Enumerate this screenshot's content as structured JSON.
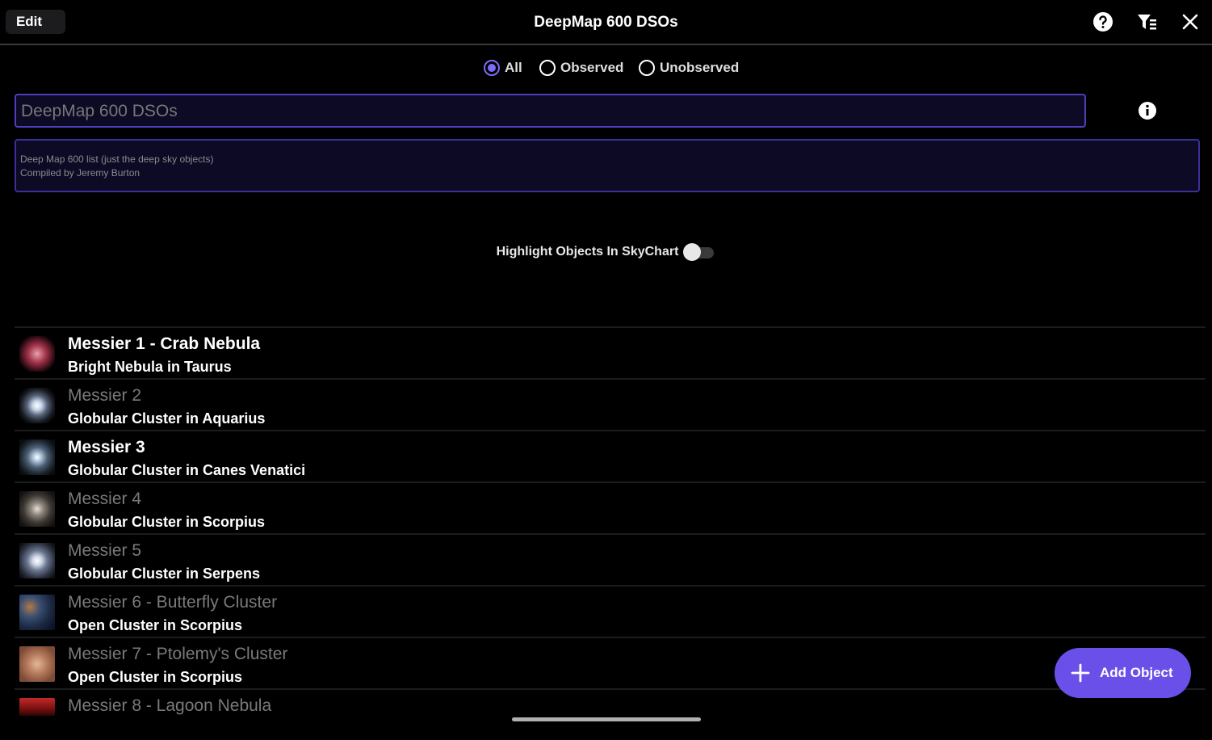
{
  "header": {
    "edit_label": "Edit",
    "title": "DeepMap 600 DSOs",
    "icons": [
      "help-icon",
      "filter-icon",
      "close-icon"
    ]
  },
  "filter": {
    "options": [
      {
        "label": "All",
        "selected": true
      },
      {
        "label": "Observed",
        "selected": false
      },
      {
        "label": "Unobserved",
        "selected": false
      }
    ]
  },
  "list_name": {
    "value": "DeepMap 600 DSOs"
  },
  "description": {
    "line1": "Deep Map 600 list (just the deep sky objects)",
    "line2": "Compiled by Jeremy Burton"
  },
  "highlight": {
    "label": "Highlight Objects In SkyChart",
    "enabled": false
  },
  "objects": [
    {
      "name": "Messier 1 - Crab Nebula",
      "type": "Bright Nebula in Taurus",
      "observed": true
    },
    {
      "name": "Messier 2",
      "type": "Globular Cluster in Aquarius",
      "observed": false
    },
    {
      "name": "Messier 3",
      "type": "Globular Cluster in Canes Venatici",
      "observed": true
    },
    {
      "name": "Messier 4",
      "type": "Globular Cluster in Scorpius",
      "observed": false
    },
    {
      "name": "Messier 5",
      "type": "Globular Cluster in Serpens",
      "observed": false
    },
    {
      "name": "Messier 6 - Butterfly Cluster",
      "type": "Open Cluster in Scorpius",
      "observed": false
    },
    {
      "name": "Messier 7 - Ptolemy's Cluster",
      "type": "Open Cluster in Scorpius",
      "observed": false
    },
    {
      "name": "Messier 8 - Lagoon Nebula",
      "type": "",
      "observed": false
    }
  ],
  "fab": {
    "label": "Add Object"
  },
  "colors": {
    "accent": "#6a4fe8",
    "field_border": "#4b3fbf",
    "dim_text": "#7a7a7a"
  }
}
